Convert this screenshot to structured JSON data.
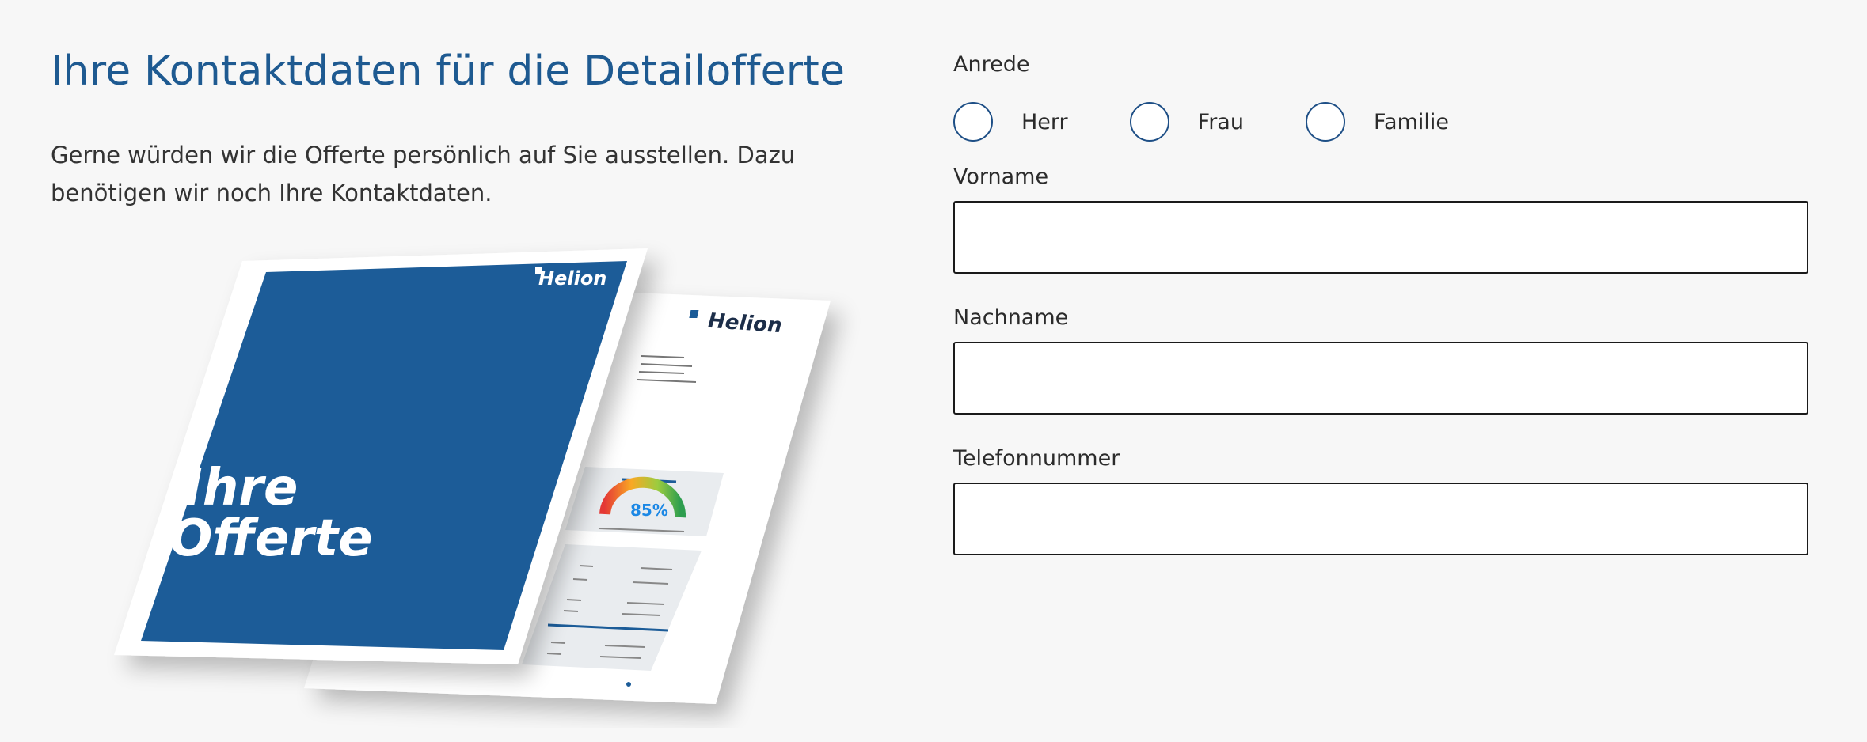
{
  "left": {
    "title": "Ihre Kontaktdaten für die Detailofferte",
    "intro": "Gerne würden wir die Offerte persönlich auf Sie ausstellen. Dazu benötigen wir noch Ihre Kontaktdaten.",
    "brochure": {
      "brand": "Helion",
      "cover_line1": "Ihre",
      "cover_line2": "Offerte",
      "gauge_value": "85%",
      "cover_color": "#1a5b98",
      "accent_color": "#1e5a91"
    }
  },
  "form": {
    "salutation_label": "Anrede",
    "salutation_options": [
      "Herr",
      "Frau",
      "Familie"
    ],
    "firstname_label": "Vorname",
    "lastname_label": "Nachname",
    "phone_label": "Telefonnummer",
    "firstname_value": "",
    "lastname_value": "",
    "phone_value": ""
  }
}
